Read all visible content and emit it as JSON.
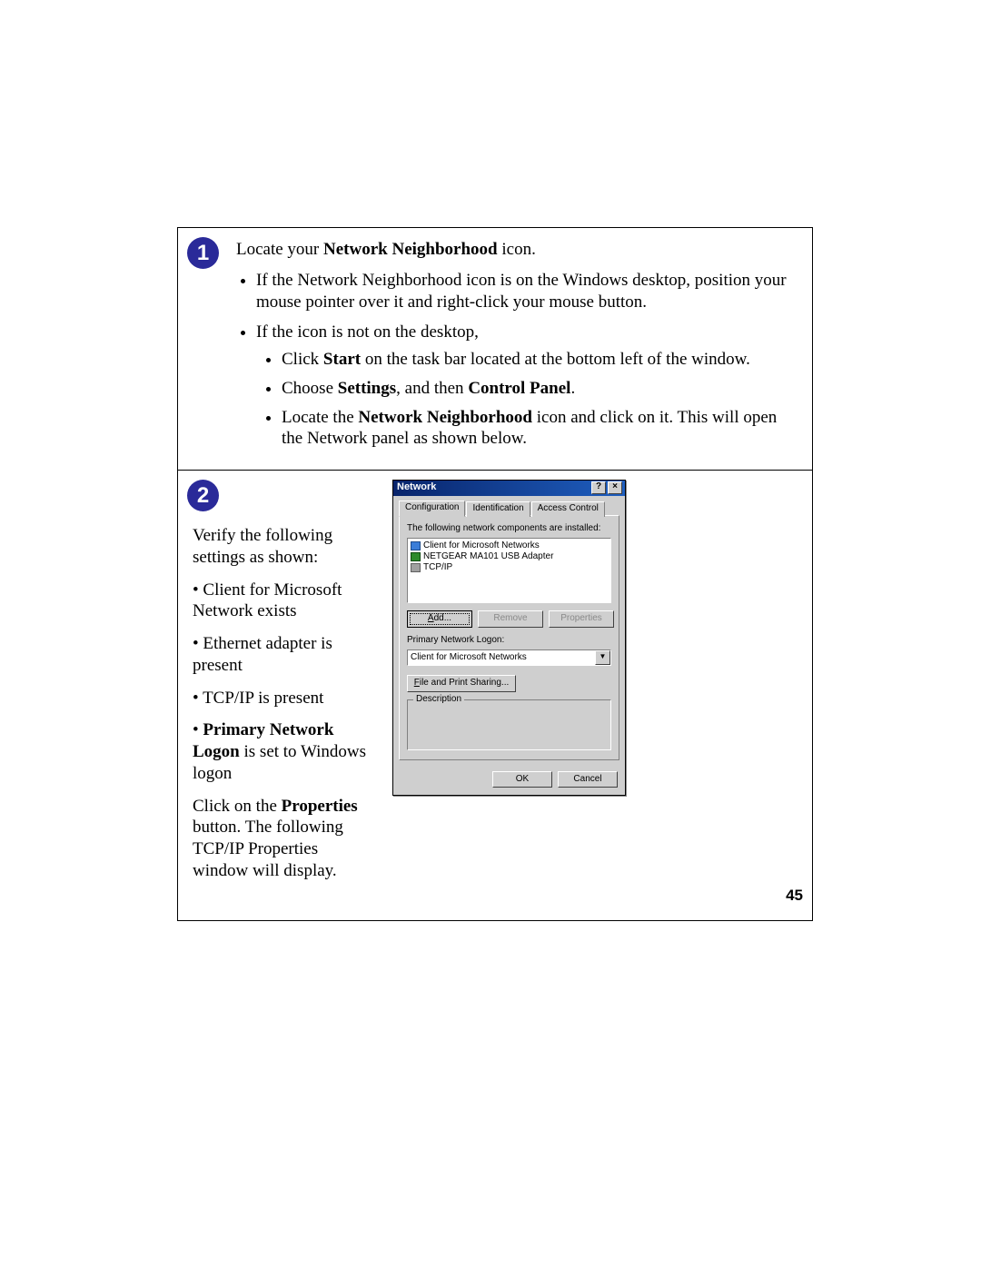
{
  "step1": {
    "badge": "1",
    "intro_pre": "Locate your ",
    "intro_bold": "Network Neighborhood",
    "intro_post": " icon.",
    "bullets": [
      {
        "text": "If the Network Neighborhood icon is on the Windows desktop, position your mouse pointer over it and right-click your mouse button."
      },
      {
        "text": "If the icon is not on the desktop,",
        "sub": [
          {
            "pre": "Click ",
            "b1": "Start",
            "post": " on the task bar located at the bottom left of the window."
          },
          {
            "pre": "Choose ",
            "b1": "Settings",
            "mid": ", and then ",
            "b2": "Control Panel",
            "post": "."
          },
          {
            "pre": "Locate the ",
            "b1": "Network Neighborhood",
            "post": " icon and click on it. This will open the Network panel as shown below."
          }
        ]
      }
    ]
  },
  "step2": {
    "badge": "2",
    "text1": "Verify the following settings as shown:",
    "bul1": "Client for Microsoft Network exists",
    "bul2": "Ethernet adapter is present",
    "bul3": "TCP/IP is present",
    "bul4_b": "Primary Network Logon",
    "bul4_rest": " is set to Windows logon",
    "text2_pre": "Click on the ",
    "text2_b": "Properties",
    "text2_post": " button. The following TCP/IP Properties window will display."
  },
  "dialog": {
    "title": "Network",
    "help_btn": "?",
    "close_btn": "×",
    "tabs": {
      "t1": "Configuration",
      "t2": "Identification",
      "t3": "Access Control"
    },
    "components_label": "The following network components are installed:",
    "items": {
      "i1": "Client for Microsoft Networks",
      "i2": "NETGEAR MA101 USB Adapter",
      "i3": "TCP/IP"
    },
    "buttons": {
      "add_u": "A",
      "add_rest": "dd...",
      "remove": "Remove",
      "properties": "Properties"
    },
    "logon_label": "Primary Network Logon:",
    "logon_value": "Client for Microsoft Networks",
    "fps_u": "F",
    "fps_rest": "ile and Print Sharing...",
    "desc_legend": "Description",
    "ok": "OK",
    "cancel": "Cancel"
  },
  "page_number": "45"
}
